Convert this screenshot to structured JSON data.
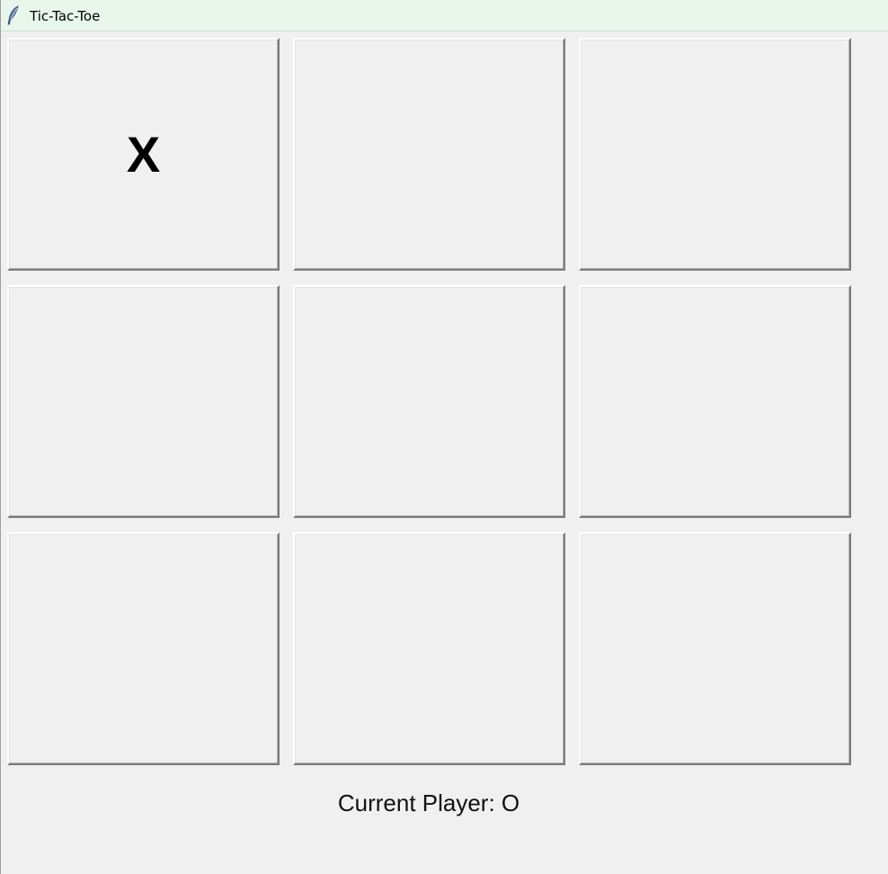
{
  "window": {
    "title": "Tic-Tac-Toe",
    "icon": "feather-icon"
  },
  "board": {
    "cells": [
      [
        "X",
        "",
        ""
      ],
      [
        "",
        "",
        ""
      ],
      [
        "",
        "",
        ""
      ]
    ]
  },
  "status": {
    "text": "Current Player: O"
  }
}
